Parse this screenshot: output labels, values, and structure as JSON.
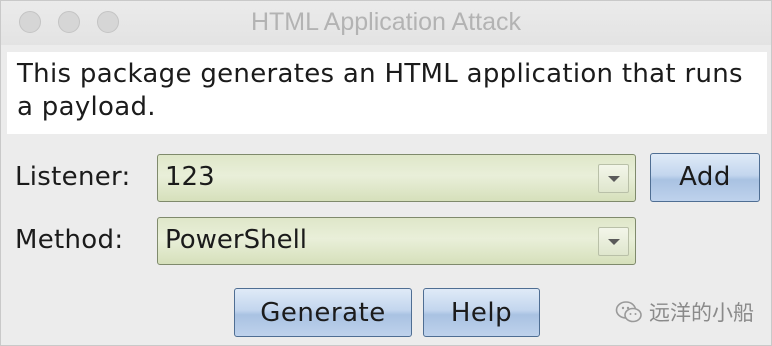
{
  "window": {
    "title": "HTML Application Attack"
  },
  "description": "This package generates an HTML application that runs a payload.",
  "listener": {
    "label": "Listener:",
    "value": "123",
    "add_button": "Add"
  },
  "method": {
    "label": "Method:",
    "value": "PowerShell"
  },
  "buttons": {
    "generate": "Generate",
    "help": "Help"
  },
  "watermark": {
    "text": "远洋的小船",
    "icon": "wechat-icon"
  }
}
